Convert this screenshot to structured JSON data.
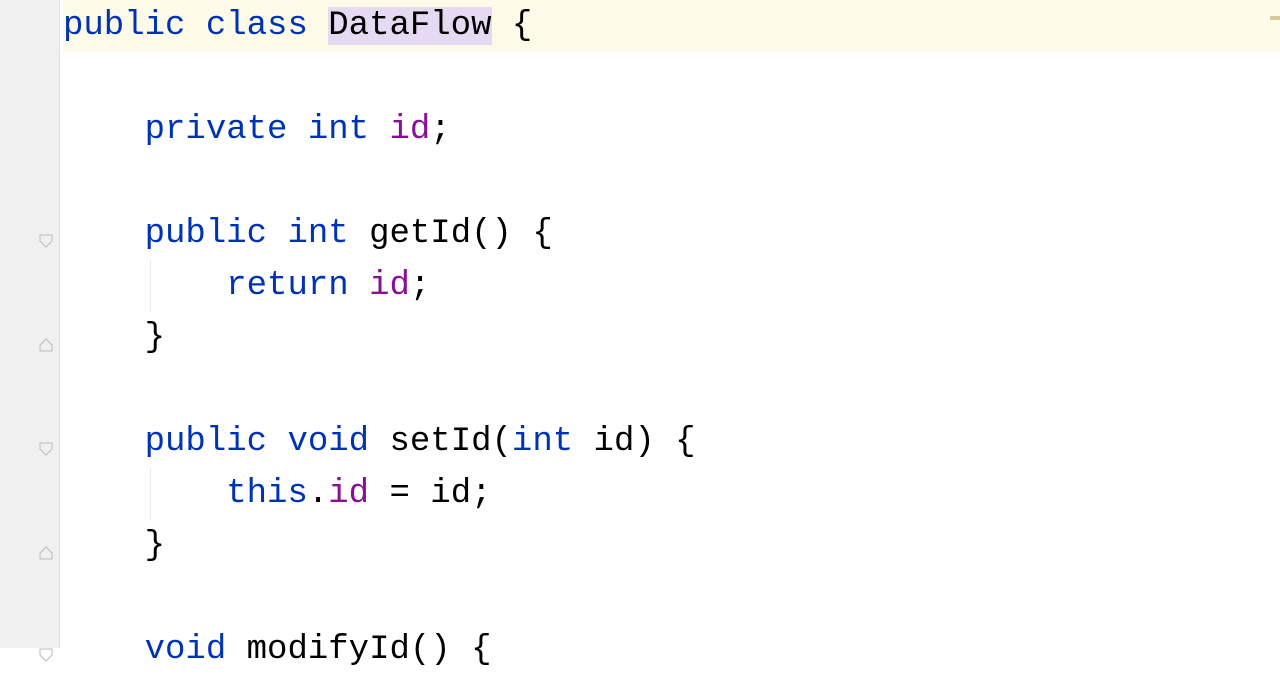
{
  "code": {
    "line1": {
      "kw_public": "public",
      "kw_class": "class",
      "classname": "DataFlow",
      "brace": " {"
    },
    "line2": "",
    "line3": {
      "kw_private": "private",
      "type": "int",
      "field": "id",
      "semi": ";"
    },
    "line4": "",
    "line5": {
      "kw_public": "public",
      "type": "int",
      "method": "getId",
      "parens": "()",
      "brace": " {"
    },
    "line6": {
      "kw_return": "return",
      "field": "id",
      "semi": ";"
    },
    "line7": {
      "brace": "}"
    },
    "line8": "",
    "line9": "",
    "line10": {
      "kw_public": "public",
      "kw_void": "void",
      "method": "setId",
      "lparen": "(",
      "type": "int",
      "param": "id",
      "rparen": ")",
      "brace": " {"
    },
    "line11": {
      "kw_this": "this",
      "dot": ".",
      "field": "id",
      "eq": " = ",
      "param": "id",
      "semi": ";"
    },
    "line12": {
      "brace": "}"
    },
    "line13": "",
    "line14": {
      "kw_void": "void",
      "method": "modifyId",
      "parens": "()",
      "brace": " {"
    }
  }
}
